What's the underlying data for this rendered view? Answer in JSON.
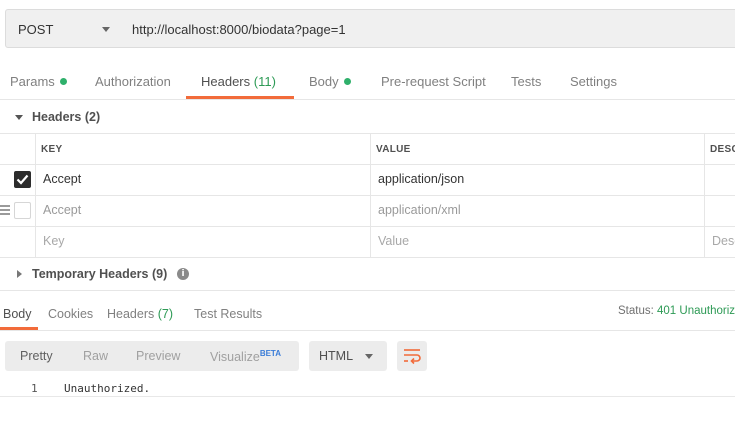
{
  "request": {
    "method": "POST",
    "url": "http://localhost:8000/biodata?page=1"
  },
  "request_tabs": [
    {
      "label": "Params",
      "dot": true
    },
    {
      "label": "Authorization"
    },
    {
      "label": "Headers",
      "count": "(11)",
      "active": true
    },
    {
      "label": "Body",
      "dot": true
    },
    {
      "label": "Pre-request Script"
    },
    {
      "label": "Tests"
    },
    {
      "label": "Settings"
    }
  ],
  "headers_section": {
    "title": "Headers",
    "count": "(2)",
    "columns": {
      "key": "KEY",
      "value": "VALUE",
      "description": "DESC"
    },
    "rows": [
      {
        "key": "Accept",
        "value": "application/json",
        "enabled": true
      },
      {
        "key": "Accept",
        "value": "application/xml",
        "enabled": false
      }
    ],
    "placeholder": {
      "key": "Key",
      "value": "Value",
      "description": "Desc"
    }
  },
  "temporary_headers": {
    "title": "Temporary Headers",
    "count": "(9)",
    "info_icon": "i"
  },
  "response_tabs": [
    {
      "label": "Body",
      "active": true
    },
    {
      "label": "Cookies"
    },
    {
      "label": "Headers",
      "count": "(7)"
    },
    {
      "label": "Test Results"
    }
  ],
  "status": {
    "label": "Status:",
    "value": "401 Unauthoriz"
  },
  "view_options": [
    {
      "label": "Pretty",
      "active": true
    },
    {
      "label": "Raw"
    },
    {
      "label": "Preview"
    },
    {
      "label": "Visualize",
      "badge": "BETA"
    }
  ],
  "format": {
    "selected": "HTML"
  },
  "body_lines": [
    {
      "number": "1",
      "text": "Unauthorized."
    }
  ],
  "colors": {
    "accent": "#f26b3a",
    "count_green": "#2d9a55",
    "checkbox_checked": "#2c2c2c",
    "beta_blue": "#3b7dd8"
  },
  "icons": [
    "chevron-down-icon",
    "checkbox-icon",
    "drag-handle-icon",
    "info-icon",
    "wrap-lines-icon"
  ]
}
